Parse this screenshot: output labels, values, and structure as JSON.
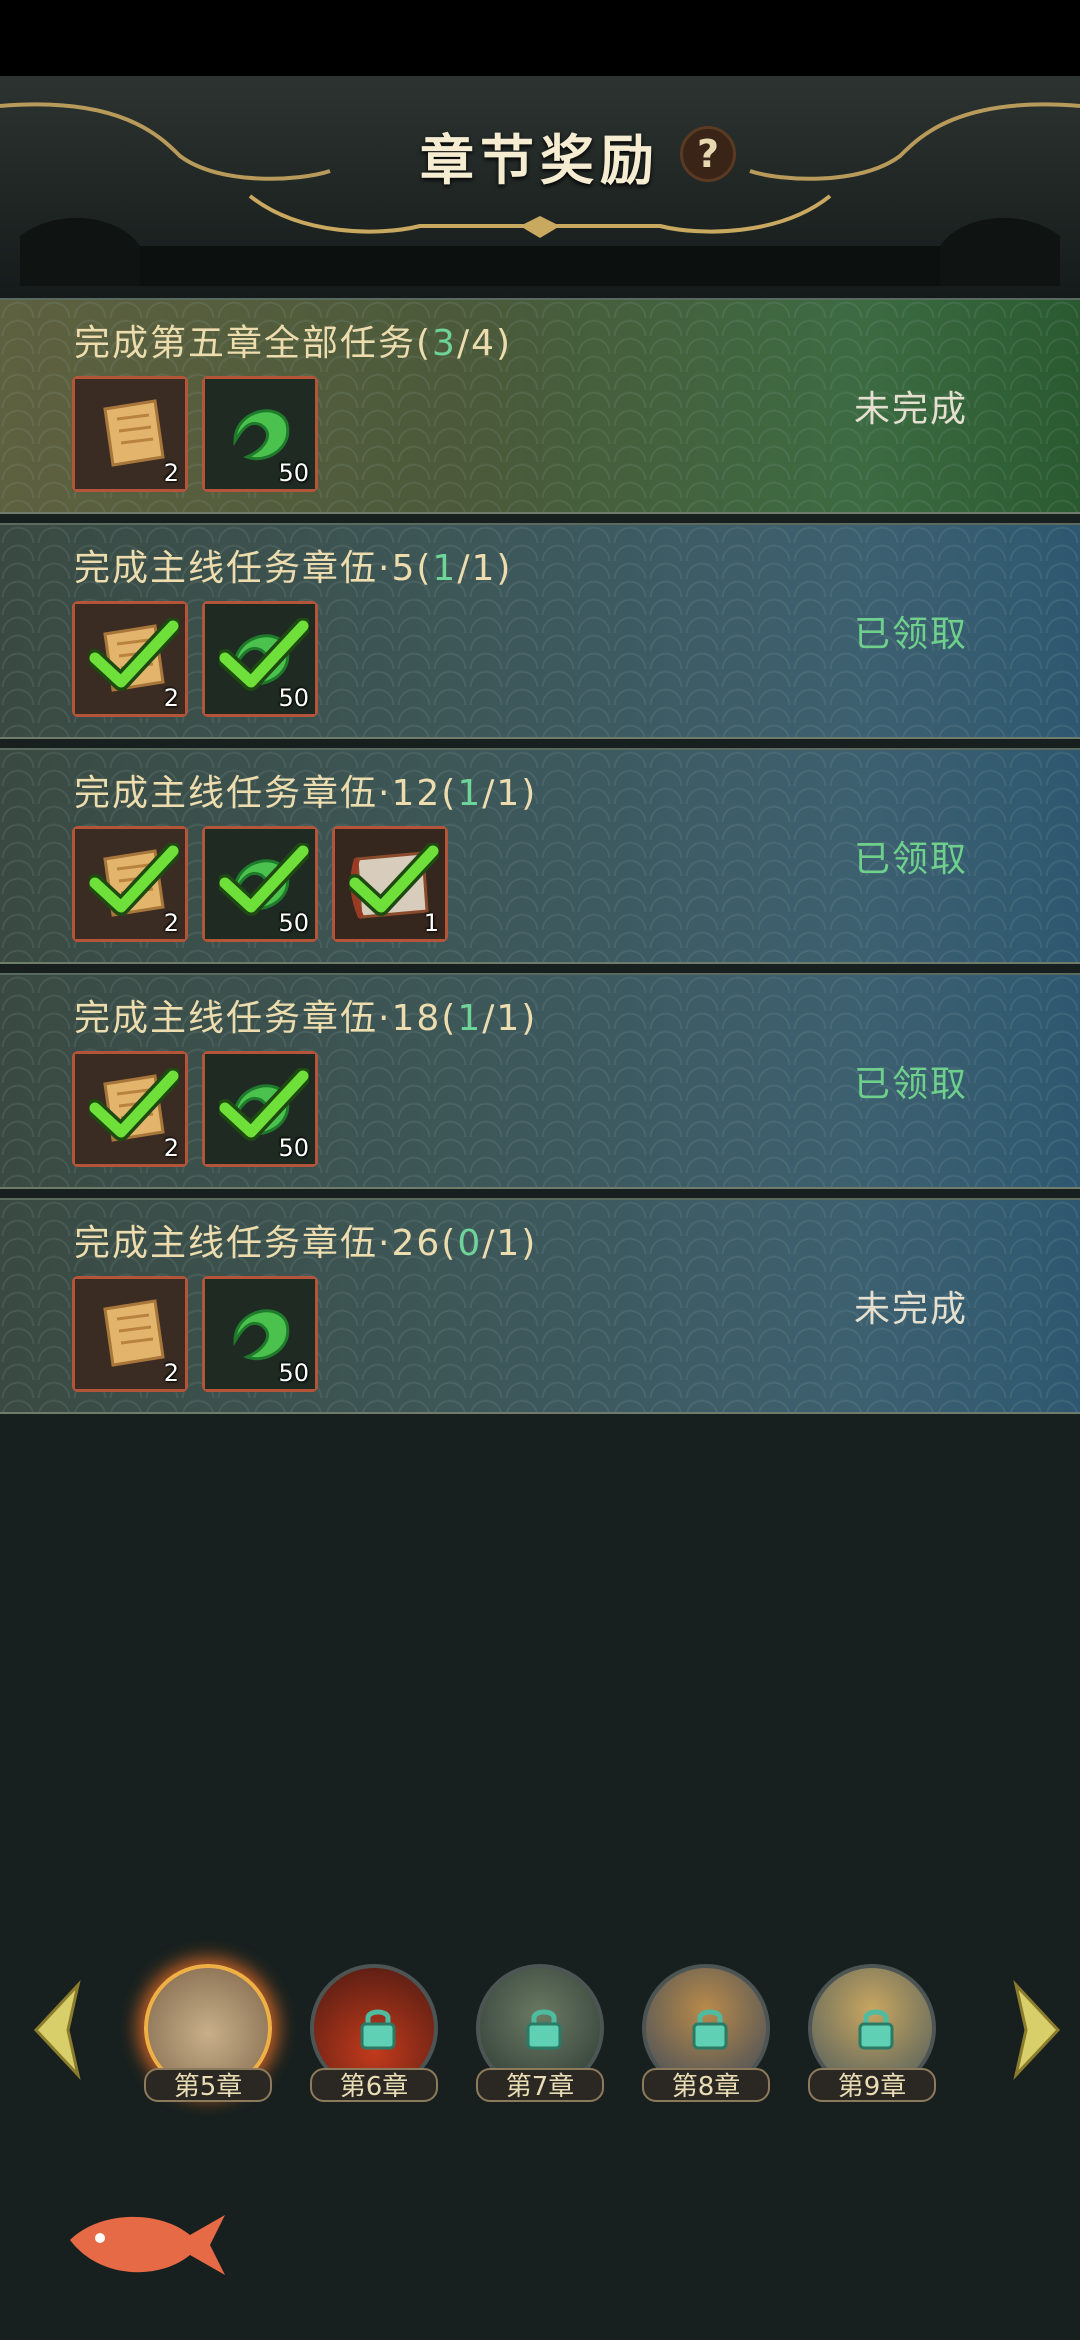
{
  "header": {
    "title": "章节奖励",
    "help_label": "?"
  },
  "tasks": [
    {
      "title_prefix": "完成第五章全部任务(",
      "current": "3",
      "rest": "/4)",
      "status": "未完成",
      "status_type": "pending",
      "rewards": [
        {
          "icon": "scroll-icon",
          "count": "2",
          "claimed": false
        },
        {
          "icon": "jade-icon",
          "count": "50",
          "claimed": false
        }
      ]
    },
    {
      "title_prefix": "完成主线任务章伍·5(",
      "current": "1",
      "rest": "/1)",
      "status": "已领取",
      "status_type": "done",
      "rewards": [
        {
          "icon": "scroll-icon",
          "count": "2",
          "claimed": true
        },
        {
          "icon": "jade-icon",
          "count": "50",
          "claimed": true
        }
      ]
    },
    {
      "title_prefix": "完成主线任务章伍·12(",
      "current": "1",
      "rest": "/1)",
      "status": "已领取",
      "status_type": "done",
      "rewards": [
        {
          "icon": "scroll-icon",
          "count": "2",
          "claimed": true
        },
        {
          "icon": "jade-icon",
          "count": "50",
          "claimed": true
        },
        {
          "icon": "map-scroll-icon",
          "count": "1",
          "claimed": true
        }
      ]
    },
    {
      "title_prefix": "完成主线任务章伍·18(",
      "current": "1",
      "rest": "/1)",
      "status": "已领取",
      "status_type": "done",
      "rewards": [
        {
          "icon": "scroll-icon",
          "count": "2",
          "claimed": true
        },
        {
          "icon": "jade-icon",
          "count": "50",
          "claimed": true
        }
      ]
    },
    {
      "title_prefix": "完成主线任务章伍·26(",
      "current": "0",
      "rest": "/1)",
      "status": "未完成",
      "status_type": "pending",
      "rewards": [
        {
          "icon": "scroll-icon",
          "count": "2",
          "claimed": false
        },
        {
          "icon": "jade-icon",
          "count": "50",
          "claimed": false
        }
      ]
    }
  ],
  "chapters": [
    {
      "label": "第5章",
      "active": true,
      "locked": false
    },
    {
      "label": "第6章",
      "active": false,
      "locked": true
    },
    {
      "label": "第7章",
      "active": false,
      "locked": true
    },
    {
      "label": "第8章",
      "active": false,
      "locked": true
    },
    {
      "label": "第9章",
      "active": false,
      "locked": true
    }
  ],
  "colors": {
    "accent_gold": "#ecdcae",
    "done_green": "#6fd08c",
    "progress_green": "#6ed49a",
    "frame_red": "#b4553a"
  }
}
